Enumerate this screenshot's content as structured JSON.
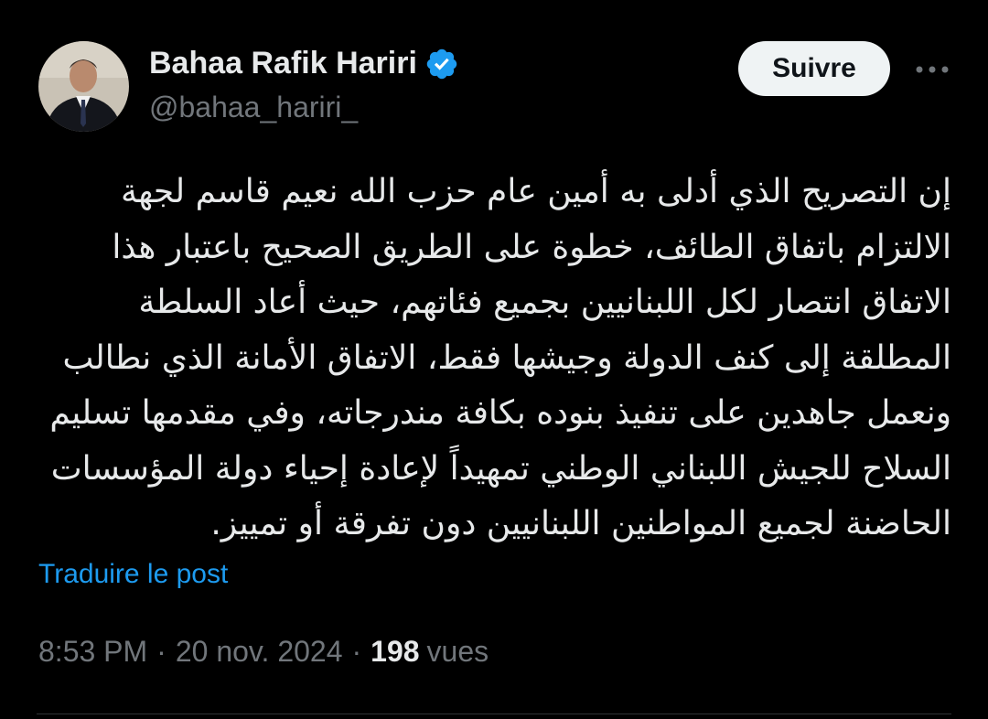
{
  "author": {
    "name": "Bahaa Rafik Hariri",
    "handle": "@bahaa_hariri_",
    "verified": true,
    "avatar": "profile-photo"
  },
  "header": {
    "follow_label": "Suivre",
    "more_icon": "ellipsis-icon"
  },
  "tweet": {
    "lines": [
      "إن التصريح الذي أدلى به أمين عام حزب الله نعيم قاسم لجهة",
      "الالتزام باتفاق الطائف، خطوة على الطريق الصحيح باعتبار هذا",
      "الاتفاق انتصار لكل اللبنانيين بجميع فئاتهم، حيث أعاد السلطة",
      "المطلقة إلى كنف الدولة وجيشها فقط، الاتفاق الأمانة الذي نطالب",
      "ونعمل جاهدين على تنفيذ بنوده بكافة مندرجاته، وفي مقدمها تسليم",
      "السلاح للجيش اللبناني الوطني تمهيداً لإعادة إحياء دولة المؤسسات",
      "الحاضنة لجميع المواطنين اللبنانيين دون تفرقة أو تمييز."
    ],
    "translate_label": "Traduire le post"
  },
  "meta": {
    "time": "8:53 PM",
    "date": "20 nov. 2024",
    "separator": "·",
    "views_count": "198",
    "views_label": "vues"
  },
  "colors": {
    "background": "#000000",
    "text_primary": "#e7e9ea",
    "text_secondary": "#71767b",
    "accent": "#1d9bf0",
    "button_bg": "#eff3f4",
    "divider": "#2f3336"
  }
}
